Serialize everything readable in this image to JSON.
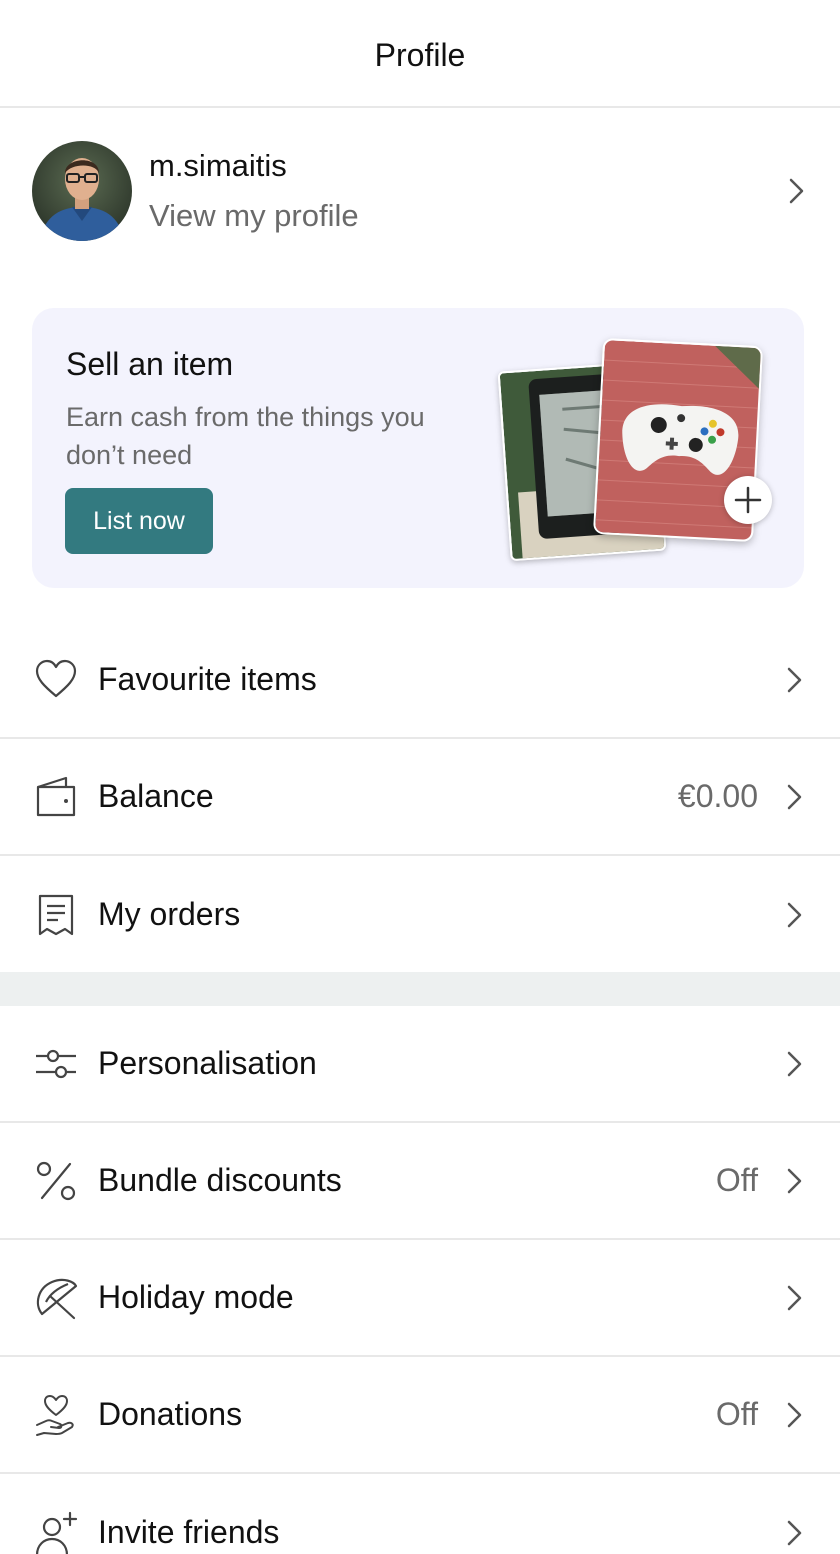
{
  "header": {
    "title": "Profile"
  },
  "profile": {
    "username": "m.simaitis",
    "subtitle": "View my profile"
  },
  "sell_card": {
    "title": "Sell an item",
    "description": "Earn cash from the things you don’t need",
    "button_label": "List now",
    "accent_color": "#337a80",
    "background_color": "#f3f3fd"
  },
  "menu_group_1": [
    {
      "icon": "heart-icon",
      "label": "Favourite items",
      "value": ""
    },
    {
      "icon": "wallet-icon",
      "label": "Balance",
      "value": "€0.00"
    },
    {
      "icon": "receipt-icon",
      "label": "My orders",
      "value": ""
    }
  ],
  "menu_group_2": [
    {
      "icon": "sliders-icon",
      "label": "Personalisation",
      "value": ""
    },
    {
      "icon": "percent-icon",
      "label": "Bundle discounts",
      "value": "Off"
    },
    {
      "icon": "umbrella-icon",
      "label": "Holiday mode",
      "value": ""
    },
    {
      "icon": "donation-hand-heart-icon",
      "label": "Donations",
      "value": "Off"
    },
    {
      "icon": "add-user-icon",
      "label": "Invite friends",
      "value": ""
    }
  ]
}
